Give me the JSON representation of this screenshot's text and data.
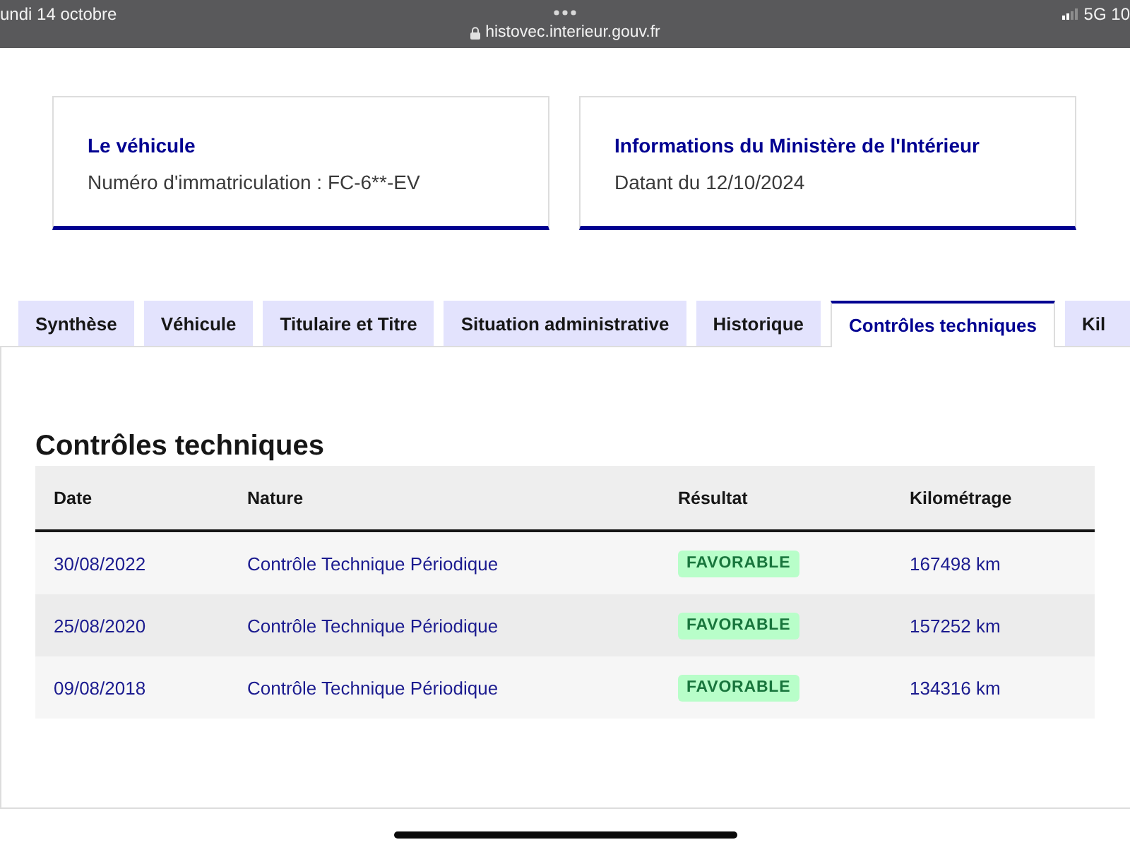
{
  "status_bar": {
    "date": "undi 14 octobre",
    "url": "histovec.interieur.gouv.fr",
    "network": "5G 10"
  },
  "cards": [
    {
      "title": "Le véhicule",
      "text": "Numéro d'immatriculation : FC-6**-EV"
    },
    {
      "title": "Informations du Ministère de l'Intérieur",
      "text": "Datant du 12/10/2024"
    }
  ],
  "tabs": [
    {
      "label": "Synthèse",
      "selected": false
    },
    {
      "label": "Véhicule",
      "selected": false
    },
    {
      "label": "Titulaire et Titre",
      "selected": false
    },
    {
      "label": "Situation administrative",
      "selected": false
    },
    {
      "label": "Historique",
      "selected": false
    },
    {
      "label": "Contrôles techniques",
      "selected": true
    },
    {
      "label": "Kil",
      "selected": false
    }
  ],
  "section": {
    "title": "Contrôles techniques",
    "table": {
      "columns": [
        "Date",
        "Nature",
        "Résultat",
        "Kilométrage"
      ],
      "rows": [
        {
          "date": "30/08/2022",
          "nature": "Contrôle Technique Périodique",
          "result": "FAVORABLE",
          "mileage": "167498 km"
        },
        {
          "date": "25/08/2020",
          "nature": "Contrôle Technique Périodique",
          "result": "FAVORABLE",
          "mileage": "157252 km"
        },
        {
          "date": "09/08/2018",
          "nature": "Contrôle Technique Périodique",
          "result": "FAVORABLE",
          "mileage": "134316 km"
        }
      ]
    }
  }
}
